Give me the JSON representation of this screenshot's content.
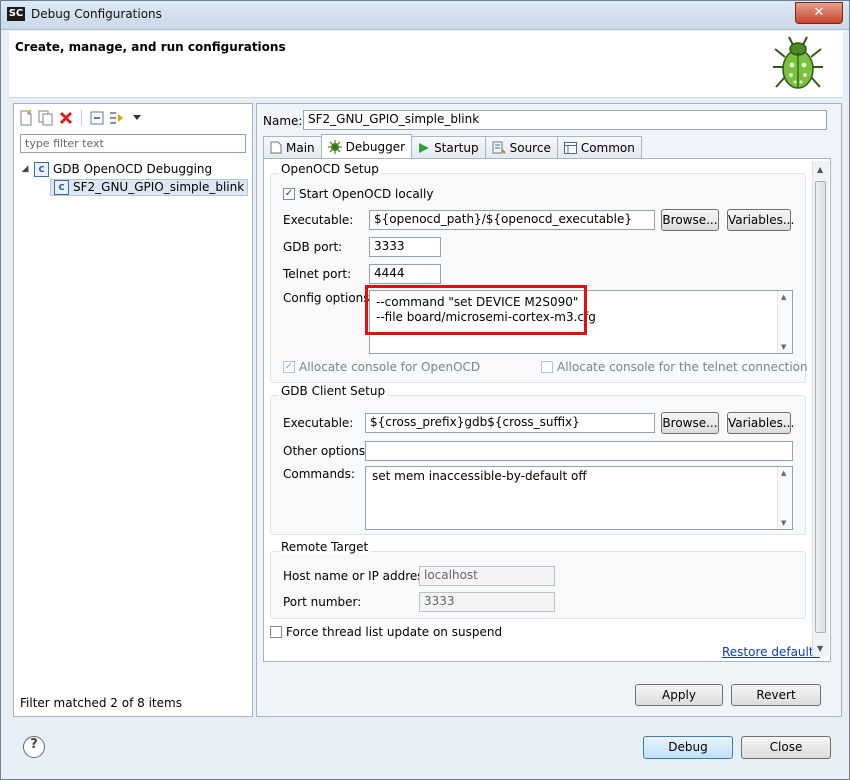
{
  "window": {
    "title": "Debug Configurations",
    "icon_text": "SC",
    "close_glyph": "✕"
  },
  "header": {
    "title": "Create, manage, and run configurations",
    "icon": "bug-icon"
  },
  "left": {
    "toolbar_icons": [
      "new-config-icon",
      "duplicate-icon",
      "delete-icon",
      "collapse-all-icon",
      "filter-icon",
      "dropdown-arrow-icon"
    ],
    "filter_placeholder": "type filter text",
    "tree": [
      {
        "label": "GDB OpenOCD Debugging",
        "expanded": true,
        "icon_letter": "C"
      },
      {
        "label": "SF2_GNU_GPIO_simple_blink",
        "selected": true,
        "icon_letter": "C"
      }
    ],
    "status": "Filter matched 2 of 8 items"
  },
  "right": {
    "name_label": "Name:",
    "name_value": "SF2_GNU_GPIO_simple_blink",
    "tabs": [
      "Main",
      "Debugger",
      "Startup",
      "Source",
      "Common"
    ],
    "active_tab": "Debugger",
    "openocd": {
      "group": "OpenOCD Setup",
      "start_locally": "Start OpenOCD locally",
      "start_checked": true,
      "executable_label": "Executable:",
      "executable_value": "${openocd_path}/${openocd_executable}",
      "browse": "Browse...",
      "variables": "Variables...",
      "gdb_port_label": "GDB port:",
      "gdb_port": "3333",
      "telnet_port_label": "Telnet port:",
      "telnet_port": "4444",
      "config_label": "Config options:",
      "config_lines": [
        "--command \"set DEVICE M2S090\"",
        "--file board/microsemi-cortex-m3.cfg"
      ],
      "alloc_console": "Allocate console for OpenOCD",
      "alloc_telnet": "Allocate console for the telnet connection"
    },
    "gdb": {
      "group": "GDB Client Setup",
      "executable_label": "Executable:",
      "executable_value": "${cross_prefix}gdb${cross_suffix}",
      "browse": "Browse...",
      "variables": "Variables...",
      "other_label": "Other options:",
      "other_value": "",
      "commands_label": "Commands:",
      "commands_lines": [
        "set mem inaccessible-by-default off"
      ]
    },
    "remote": {
      "group": "Remote Target",
      "host_label": "Host name or IP address:",
      "host_value": "localhost",
      "port_label": "Port number:",
      "port_value": "3333"
    },
    "force_thread": "Force thread list update on suspend",
    "restore": "Restore defaults",
    "apply": "Apply",
    "revert": "Revert"
  },
  "footer": {
    "help": "?",
    "debug": "Debug",
    "close": "Close"
  },
  "colors": {
    "highlight": "#e01010",
    "link": "#0b3fae"
  }
}
